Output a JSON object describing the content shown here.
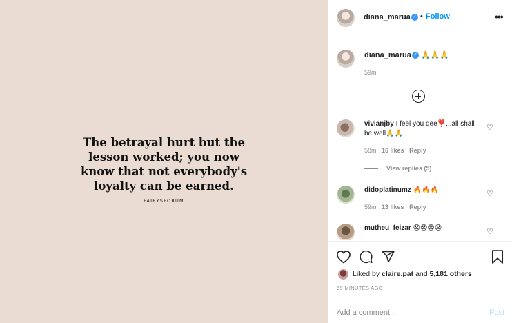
{
  "post_image": {
    "quote": "The betrayal hurt but the\nlesson worked; you now\nknow that not everybody's\nloyalty can be earned.",
    "source": "FAIRYSFORUM"
  },
  "header": {
    "username": "diana_marua",
    "separator": "•",
    "follow_label": "Follow",
    "more_icon": "more-options-icon"
  },
  "caption": {
    "username": "diana_marua",
    "text": "🙏🙏🙏",
    "time": "59m"
  },
  "comments": [
    {
      "username": "vivianjby",
      "text": "I feel you dee❣️...all shall be well🙏🙏",
      "time": "58m",
      "likes": "16 likes",
      "reply_label": "Reply",
      "view_replies": "View replies (5)"
    },
    {
      "username": "didoplatinumz",
      "text": "🔥🔥🔥",
      "time": "59m",
      "likes": "13 likes",
      "reply_label": "Reply"
    },
    {
      "username": "mutheu_feizar",
      "text": "😧😧😧😧"
    }
  ],
  "actions": {
    "liked_prefix": "Liked by",
    "liked_user": "claire.pat",
    "liked_and": "and",
    "liked_others": "5,181 others",
    "timestamp": "59 MINUTES AGO"
  },
  "comment_box": {
    "placeholder": "Add a comment...",
    "post_label": "Post"
  },
  "colors": {
    "image_bg": "#ebdcd3",
    "link_blue": "#0095f6",
    "verified_blue": "#3897f0",
    "muted": "#8e8e8e"
  }
}
